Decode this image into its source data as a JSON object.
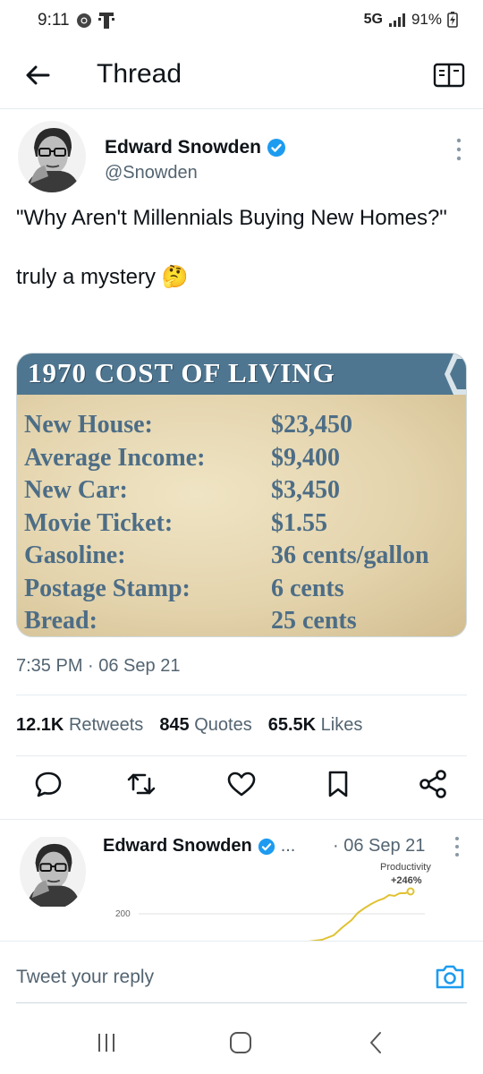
{
  "status_bar": {
    "time": "9:11",
    "network": "5G",
    "battery": "91%"
  },
  "header": {
    "title": "Thread"
  },
  "tweet": {
    "author_name": "Edward Snowden",
    "author_handle": "@Snowden",
    "text": "\"Why Aren't Millennials Buying New Homes?\"\n\ntruly a mystery 🤔",
    "media": {
      "title": "1970 COST OF LIVING",
      "rows": [
        {
          "label": "New House:",
          "value": "$23,450"
        },
        {
          "label": "Average Income:",
          "value": "$9,400"
        },
        {
          "label": "New Car:",
          "value": "$3,450"
        },
        {
          "label": "Movie Ticket:",
          "value": "$1.55"
        },
        {
          "label": "Gasoline:",
          "value": "36 cents/gallon"
        },
        {
          "label": "Postage Stamp:",
          "value": "6 cents"
        },
        {
          "label": "Bread:",
          "value": "25 cents"
        }
      ]
    },
    "timestamp": "7:35 PM · 06 Sep 21",
    "stats": {
      "retweets_count": "12.1K",
      "retweets_label": "Retweets",
      "quotes_count": "845",
      "quotes_label": "Quotes",
      "likes_count": "65.5K",
      "likes_label": "Likes"
    },
    "actions": [
      "reply-icon",
      "retweet-icon",
      "like-icon",
      "bookmark-icon",
      "share-icon"
    ]
  },
  "reply_tweet": {
    "author_name": "Edward Snowden",
    "ellipsis": "...",
    "date": "· 06 Sep 21",
    "chart_label": "Productivity",
    "chart_value": "+246%",
    "chart_tick": "200"
  },
  "composer": {
    "placeholder": "Tweet your reply"
  },
  "colors": {
    "accent": "#1d9bf0",
    "text_primary": "#0f1419",
    "text_secondary": "#536471",
    "banner": "#4f7690",
    "chart_line": "#e0c233"
  }
}
